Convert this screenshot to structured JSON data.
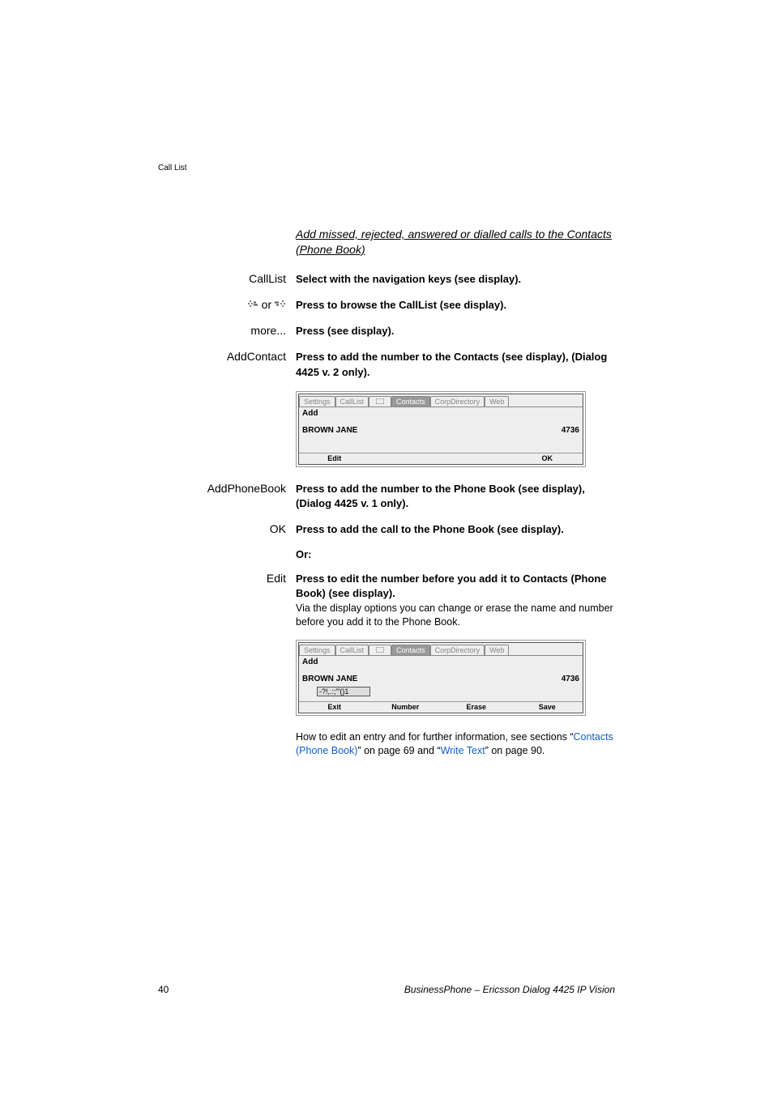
{
  "sectionHeader": "Call List",
  "subsectionTitle": "Add missed, rejected, answered or dialled calls to the Contacts (Phone Book)",
  "rows": {
    "callList": {
      "label": "CallList",
      "text": "Select with the navigation keys (see display)."
    },
    "browse": {
      "label_sep": " or ",
      "text": "Press to browse the CallList (see display)."
    },
    "more": {
      "label": "more...",
      "text": "Press (see display)."
    },
    "addContact": {
      "label": "AddContact",
      "text": "Press to add the number to the Contacts (see display), (Dialog 4425 v. 2 only)."
    },
    "addPhoneBook": {
      "label": "AddPhoneBook",
      "text": "Press to add the number to the Phone Book (see display), (Dialog 4425 v. 1 only)."
    },
    "ok": {
      "label": "OK",
      "text": "Press to add the call to the Phone Book (see display)."
    },
    "or": "Or:",
    "edit": {
      "label": "Edit",
      "text": "Press to edit the number before you add it to Contacts (Phone Book) (see display).",
      "desc": "Via the display options you can change or erase the name and number before you add it to the Phone Book."
    }
  },
  "tabs": {
    "settings": "Settings",
    "callList": "CallList",
    "contacts": "Contacts",
    "corpDirectory": "CorpDirectory",
    "web": "Web"
  },
  "display1": {
    "line1": "Add",
    "name": "BROWN JANE",
    "number": "4736",
    "softkeys": {
      "left": "Edit",
      "right": "OK"
    }
  },
  "display2": {
    "line1": "Add",
    "name": "BROWN JANE",
    "number": "4736",
    "inputHint": " -?!,.:;\"'()1",
    "softkeys": {
      "k1": "Exit",
      "k2": "Number",
      "k3": "Erase",
      "k4": "Save"
    }
  },
  "afterPara": {
    "prefix": "How to edit an entry and for further information, see sections “",
    "link1": "Contacts (Phone Book)",
    "mid": "” on page 69 and “",
    "link2": "Write Text",
    "suffix": "” on page 90."
  },
  "footer": {
    "page": "40",
    "title": "BusinessPhone – Ericsson Dialog 4425 IP Vision"
  }
}
